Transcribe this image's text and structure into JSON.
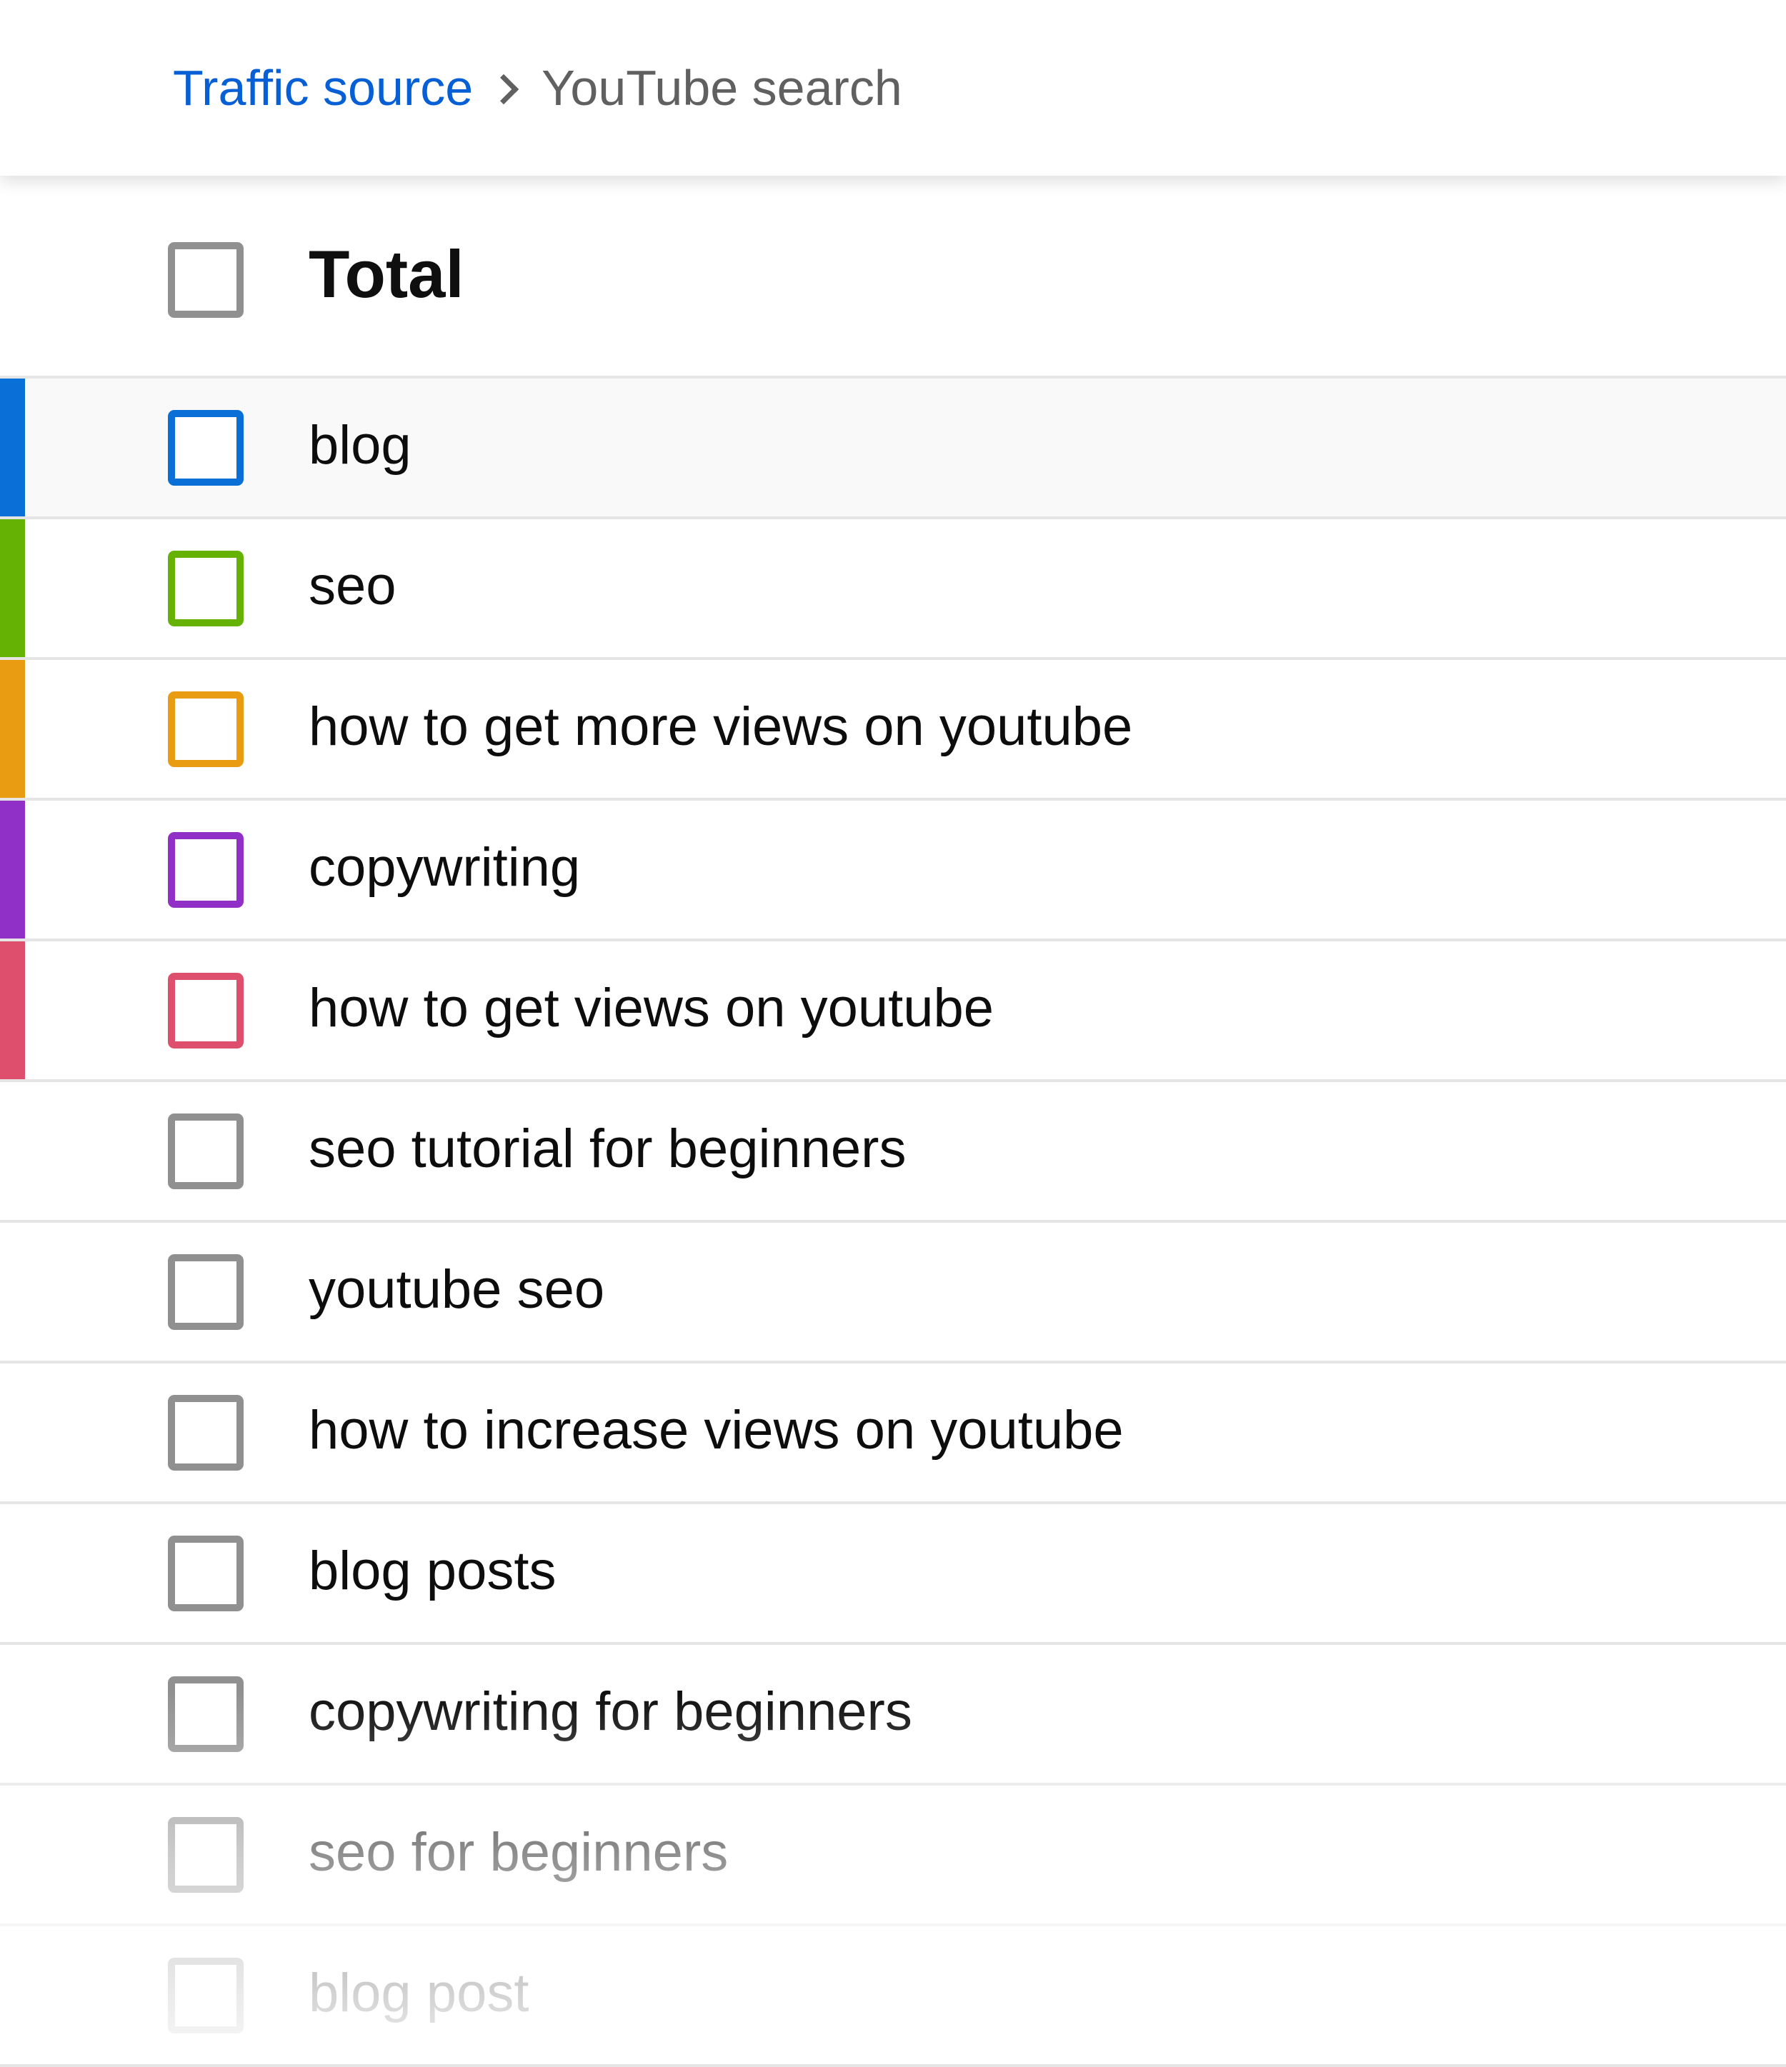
{
  "breadcrumb": {
    "parent": "Traffic source",
    "separator_icon": "chevron-right-icon",
    "current": "YouTube search"
  },
  "table": {
    "total_label": "Total",
    "rows": [
      {
        "label": "blog",
        "color": "#0a6fd6",
        "highlighted": true
      },
      {
        "label": "seo",
        "color": "#66b204"
      },
      {
        "label": "how to get more views on youtube",
        "color": "#e99c12"
      },
      {
        "label": "copywriting",
        "color": "#9130c6"
      },
      {
        "label": "how to get views on youtube",
        "color": "#dd4f6d"
      },
      {
        "label": "seo tutorial for beginners",
        "color": null
      },
      {
        "label": "youtube seo",
        "color": null
      },
      {
        "label": "how to increase views on youtube",
        "color": null
      },
      {
        "label": "blog posts",
        "color": null
      },
      {
        "label": "copywriting for beginners",
        "color": null
      },
      {
        "label": "seo for beginners",
        "color": null
      },
      {
        "label": "blog post",
        "color": null
      }
    ]
  }
}
